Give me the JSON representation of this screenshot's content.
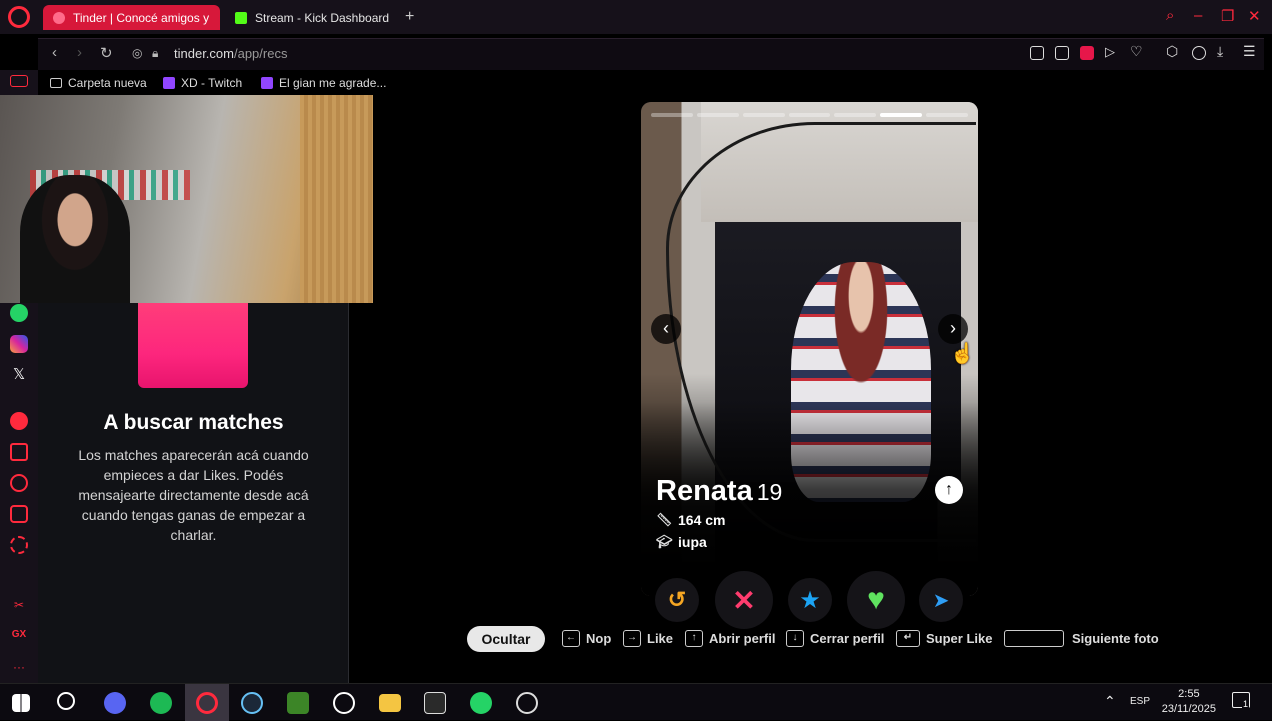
{
  "browser": {
    "tabs": [
      {
        "label": "Tinder | Conocé amigos y"
      },
      {
        "label": "Stream - Kick Dashboard"
      }
    ],
    "new_tab": "+",
    "url": {
      "host": "tinder.com",
      "path": "/app/recs"
    },
    "bookmarks": [
      {
        "label": "Carpeta nueva"
      },
      {
        "label": "XD - Twitch"
      },
      {
        "label": "El gian me agrade..."
      }
    ]
  },
  "left_panel": {
    "title": "A buscar matches",
    "body": "Los matches aparecerán acá cuando empieces a dar Likes. Podés mensajearte directamente desde acá cuando tengas ganas de empezar a charlar."
  },
  "profile": {
    "name": "Renata",
    "age": "19",
    "height": "164 cm",
    "school": "iupa",
    "photo_count": 7,
    "active_photo_index": 5
  },
  "actions": {
    "rewind_icon": "rewind-icon",
    "nope_icon": "x-icon",
    "superlike_icon": "star-icon",
    "like_icon": "heart-icon",
    "boost_icon": "send-icon"
  },
  "shortcuts": {
    "hide_label": "Ocultar",
    "items": [
      {
        "key": "←",
        "label": "Nop"
      },
      {
        "key": "→",
        "label": "Like"
      },
      {
        "key": "↑",
        "label": "Abrir perfil"
      },
      {
        "key": "↓",
        "label": "Cerrar perfil"
      },
      {
        "key": "↵",
        "label": "Super Like"
      },
      {
        "key": "",
        "label": "Siguiente foto"
      }
    ]
  },
  "taskbar": {
    "lang": "ESP",
    "time": "2:55",
    "date": "23/11/2025",
    "notifications": "1"
  },
  "colors": {
    "tinder_pink": "#fd267d",
    "opera_red": "#ff2a3d",
    "nope": "#ff3c6e",
    "superlike": "#1ca4f4",
    "like": "#5fe35f",
    "rewind": "#f5a623",
    "boost": "#2e9ef5"
  }
}
